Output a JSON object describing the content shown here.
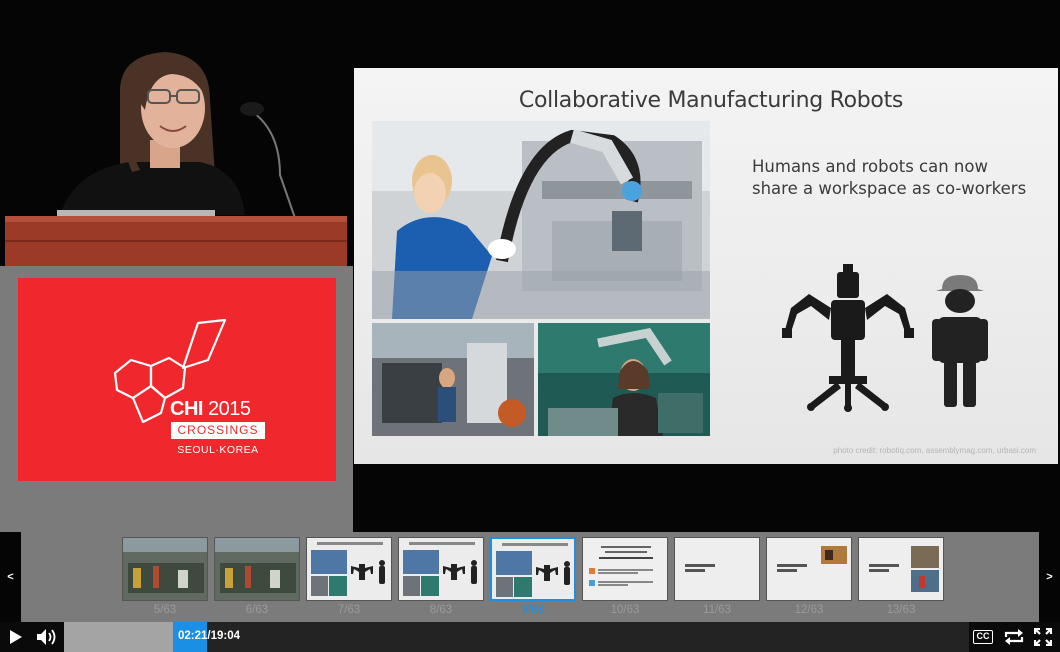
{
  "branding": {
    "conference": "CHI",
    "year": "2015",
    "theme": "CROSSINGS",
    "location": "SEOUL·KOREA",
    "brand_color": "#f0282d"
  },
  "slide": {
    "title": "Collaborative Manufacturing Robots",
    "body_line1": "Humans and robots can now",
    "body_line2": "share a workspace as co-workers",
    "photo_credit": "photo credit: robotiq.com, assemblymag.com, urbasi.com"
  },
  "thumbnails": {
    "prev_arrow": "<",
    "next_arrow": ">",
    "items": [
      {
        "label": "5/63",
        "kind": "factory"
      },
      {
        "label": "6/63",
        "kind": "factory"
      },
      {
        "label": "7/63",
        "kind": "robots"
      },
      {
        "label": "8/63",
        "kind": "robots"
      },
      {
        "label": "9/63",
        "kind": "robots",
        "active": true
      },
      {
        "label": "10/63",
        "kind": "text"
      },
      {
        "label": "11/63",
        "kind": "title"
      },
      {
        "label": "12/63",
        "kind": "title-photo"
      },
      {
        "label": "13/63",
        "kind": "title-photo2"
      }
    ]
  },
  "player": {
    "current_time": "02:21",
    "total_time": "19:04",
    "played_fraction": 0.1232,
    "buffered_fraction": 0.12,
    "cc_label": "CC",
    "accent_color": "#1a8fe3"
  }
}
